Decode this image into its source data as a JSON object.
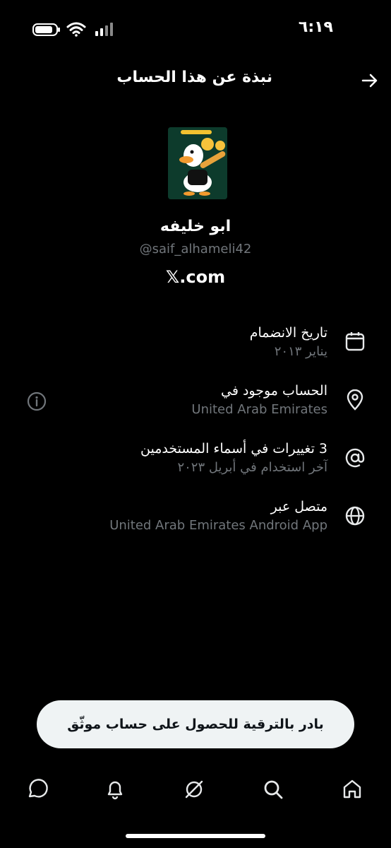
{
  "status_bar": {
    "time": "٦:١٩"
  },
  "header": {
    "title": "نبذة عن هذا الحساب",
    "back_icon": "arrow-right-icon"
  },
  "profile": {
    "display_name": "ابو خليفه",
    "handle": "@saif_alhameli42",
    "domain": "𝕏.com"
  },
  "info": [
    {
      "icon": "calendar-icon",
      "title": "تاريخ الانضمام",
      "subtitle": "يناير ٢٠١٣"
    },
    {
      "icon": "location-pin-icon",
      "title": "الحساب موجود في",
      "subtitle": "United Arab Emirates"
    },
    {
      "icon": "at-sign-icon",
      "title": "3 تغييرات في أسماء المستخدمين",
      "subtitle": "آخر استخدام في أبريل ٢٠٢٣"
    },
    {
      "icon": "globe-icon",
      "title": "متصل عبر",
      "subtitle": "United Arab Emirates Android App"
    }
  ],
  "upgrade_button": "بادر بالترقية للحصول على حساب موثّق",
  "bottom_nav": [
    "chat-bubble-icon",
    "bell-icon",
    "grok-icon",
    "search-icon",
    "home-icon"
  ]
}
